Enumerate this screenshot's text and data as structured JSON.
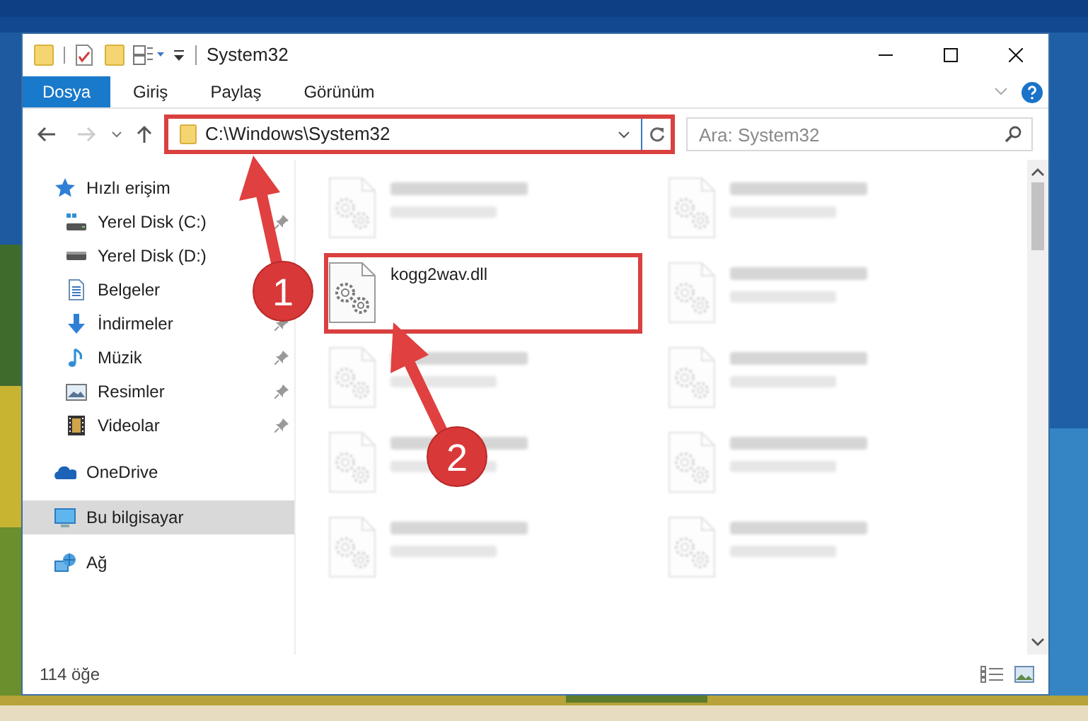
{
  "window": {
    "title": "System32"
  },
  "ribbon_tabs": [
    {
      "label": "Dosya",
      "selected": true
    },
    {
      "label": "Giriş",
      "selected": false
    },
    {
      "label": "Paylaş",
      "selected": false
    },
    {
      "label": "Görünüm",
      "selected": false
    }
  ],
  "address_bar": {
    "path": "C:\\Windows\\System32",
    "highlighted": true
  },
  "search": {
    "placeholder": "Ara: System32"
  },
  "sidebar": {
    "items": [
      {
        "label": "Hızlı erişim",
        "kind": "star",
        "selected": false,
        "children": [
          {
            "label": "Yerel Disk (C:)",
            "kind": "drive-c",
            "selected": false,
            "pinned": true
          },
          {
            "label": "Yerel Disk (D:)",
            "kind": "drive",
            "selected": false,
            "pinned": false
          },
          {
            "label": "Belgeler",
            "kind": "documents",
            "selected": false,
            "pinned": false
          },
          {
            "label": "İndirmeler",
            "kind": "download",
            "selected": false,
            "pinned": true
          },
          {
            "label": "Müzik",
            "kind": "music",
            "selected": false,
            "pinned": true
          },
          {
            "label": "Resimler",
            "kind": "pictures",
            "selected": false,
            "pinned": true
          },
          {
            "label": "Videolar",
            "kind": "videos",
            "selected": false,
            "pinned": true
          }
        ]
      },
      {
        "label": "OneDrive",
        "kind": "cloud",
        "selected": false
      },
      {
        "label": "Bu bilgisayar",
        "kind": "computer",
        "selected": true
      },
      {
        "label": "Ağ",
        "kind": "network",
        "selected": false
      }
    ]
  },
  "files": [
    {
      "kind": "blurred",
      "highlighted": false
    },
    {
      "kind": "blurred",
      "highlighted": false
    },
    {
      "kind": "file",
      "name": "kogg2wav.dll",
      "highlighted": true
    },
    {
      "kind": "blurred",
      "highlighted": false
    },
    {
      "kind": "blurred",
      "highlighted": false
    },
    {
      "kind": "blurred",
      "highlighted": false
    },
    {
      "kind": "blurred",
      "highlighted": false
    },
    {
      "kind": "blurred",
      "highlighted": false
    },
    {
      "kind": "blurred",
      "highlighted": false
    },
    {
      "kind": "blurred",
      "highlighted": false
    }
  ],
  "status_bar": {
    "count": "114 öğe"
  },
  "annotations": [
    {
      "number": "1"
    },
    {
      "number": "2"
    }
  ]
}
